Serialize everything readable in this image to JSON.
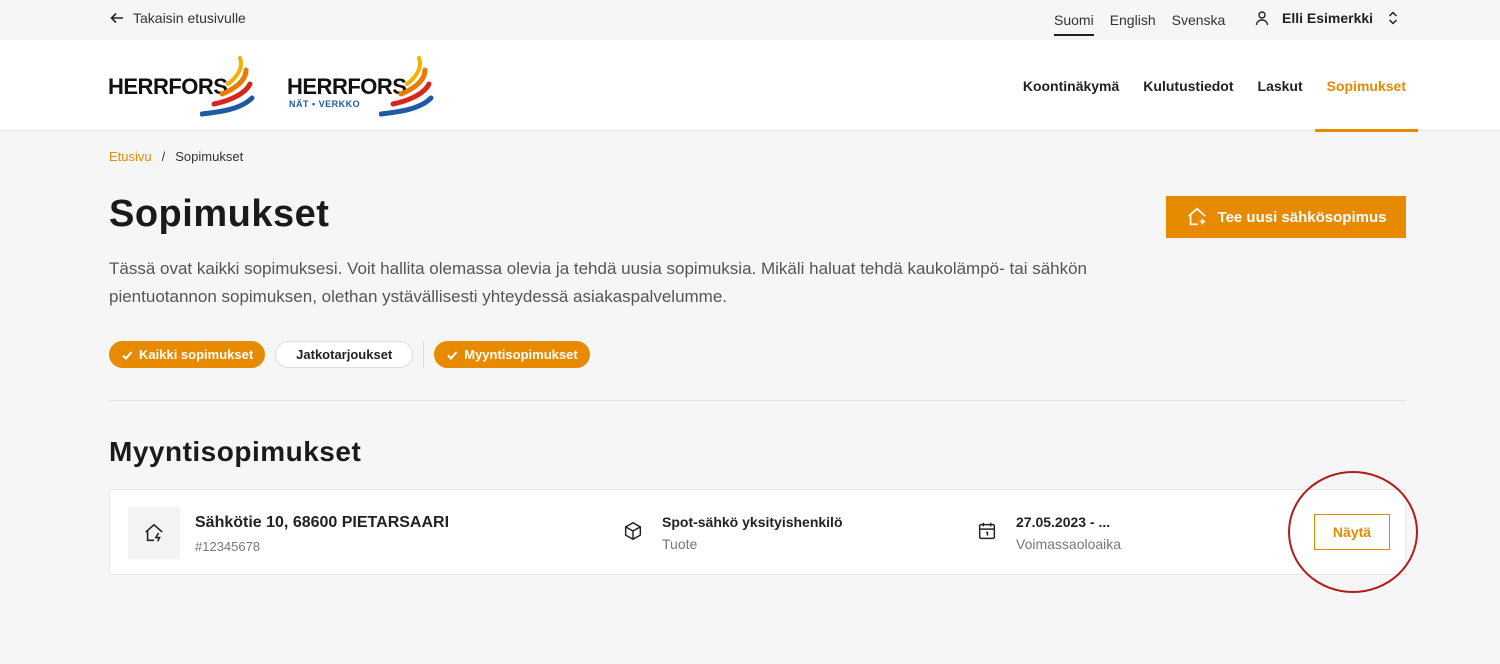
{
  "topbar": {
    "back_label": "Takaisin etusivulle",
    "languages": [
      "Suomi",
      "English",
      "Svenska"
    ],
    "active_language": "Suomi",
    "user_name": "Elli Esimerkki"
  },
  "header": {
    "logo_1": "HERRFORS",
    "logo_2": "HERRFORS",
    "logo_2_sub": "NÄT • VERKKO",
    "nav": [
      "Koontinäkymä",
      "Kulutustiedot",
      "Laskut",
      "Sopimukset"
    ],
    "active_nav": "Sopimukset"
  },
  "breadcrumb": {
    "home": "Etusivu",
    "separator": "/",
    "current": "Sopimukset"
  },
  "page": {
    "title": "Sopimukset",
    "intro": "Tässä ovat kaikki sopimuksesi. Voit hallita olemassa olevia ja tehdä uusia sopimuksia. Mikäli haluat tehdä kaukolämpö- tai sähkön pientuotannon sopimuksen, olethan ystävällisesti yhteydessä asiakaspalvelumme.",
    "new_contract_button": "Tee uusi sähkösopimus"
  },
  "filters": [
    {
      "label": "Kaikki sopimukset",
      "selected": true
    },
    {
      "label": "Jatkotarjoukset",
      "selected": false
    },
    {
      "label": "Myyntisopimukset",
      "selected": true
    }
  ],
  "section": {
    "title": "Myyntisopimukset",
    "contracts": [
      {
        "address": "Sähkötie 10, 68600 PIETARSAARI",
        "number": "#12345678",
        "product": "Spot-sähkö yksityishenkilö",
        "product_label": "Tuote",
        "validity": "27.05.2023 - ...",
        "validity_label": "Voimassaoloaika",
        "action_label": "Näytä"
      }
    ]
  },
  "colors": {
    "accent": "#e88a00",
    "highlight": "#b01c1c",
    "background": "#f6f6f6"
  }
}
